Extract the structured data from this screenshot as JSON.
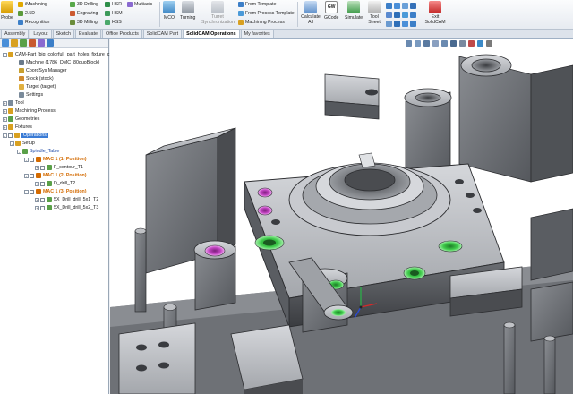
{
  "ribbon": {
    "probe": "Probe",
    "col1": [
      "iMachining",
      "2.5D",
      "Recognition"
    ],
    "col2": [
      "3D Drilling",
      "Engraving",
      "3D Milling"
    ],
    "col3": [
      "HSR",
      "HSM",
      "HSS"
    ],
    "multiaxis": "Multiaxis",
    "mco": "MCO",
    "turning": "Turning",
    "turret_sync": "Turret Synchronization",
    "templates": [
      "From Template",
      "From Process Template",
      "Machining Process"
    ],
    "calculate_all": "Calculate All",
    "gcode_badge": "GW",
    "gcode": "GCode",
    "simulate": "Simulate",
    "tool_sheet": "Tool Sheet",
    "exit": "Exit SolidCAM"
  },
  "tabs": [
    "Assembly",
    "Layout",
    "Sketch",
    "Evaluate",
    "Office Products",
    "SolidCAM Part",
    "SolidCAM Operations",
    "My favorites"
  ],
  "active_tab": "SolidCAM Operations",
  "tree": {
    "cam_part": "CAM-Part (big_colorfull_part_holes_fixture_c",
    "machine": "Machine (1786_DMC_80duoBlock)",
    "coordsys": "CoordSys Manager",
    "stock": "Stock (stock)",
    "target": "Target (target)",
    "settings": "Settings",
    "tool": "Tool",
    "machining_process": "Machining Process",
    "geometries": "Geometries",
    "fixtures": "Fixtures",
    "operations": "Operations",
    "setup": "Setup",
    "spindle_table": "Spindle_Table",
    "mac1a": "MAC 1 (1- Position)",
    "op1": "F_contour_T1",
    "mac1b": "MAC 1 (2- Position)",
    "op2": "D_drill_T2",
    "mac1c": "MAC 1 (3- Position)",
    "op3": "5X_Drill_drill_5x1_T2",
    "op4": "5X_Drill_drill_5x2_T3"
  },
  "colors": {
    "part_grey": "#8c8e92",
    "hole_green": "#3ecb4a",
    "hole_magenta": "#c445c4",
    "selection_blue": "#3a7bd5",
    "orange_label": "#d36a00"
  }
}
